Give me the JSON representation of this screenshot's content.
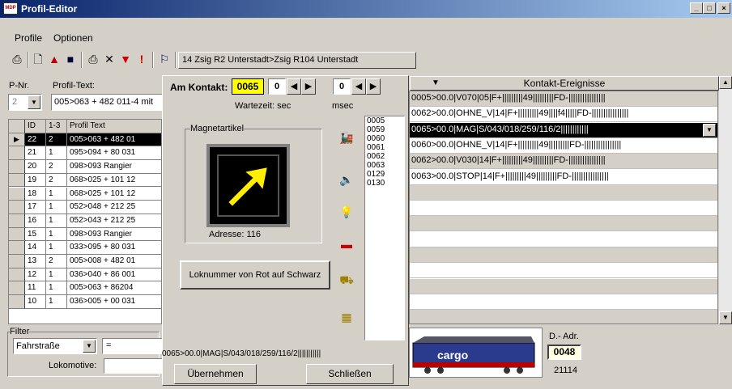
{
  "window": {
    "title": "Profil-Editor",
    "logo": "MDP",
    "min": "_",
    "max": "□",
    "close": "×"
  },
  "menu": {
    "profile": "Profile",
    "optionen": "Optionen"
  },
  "toolbar": {
    "icons": [
      "refresh-icon",
      "new-document-icon",
      "open-icon",
      "save-icon",
      "print-icon",
      "delete-icon",
      "filter-icon",
      "alert-icon",
      "network-icon"
    ],
    "route_label": "14 Zsig R2 Unterstadt>Zsig R104 Unterstadt"
  },
  "left": {
    "pnr_label": "P-Nr.",
    "pnr_value": "2",
    "profil_text_label": "Profil-Text:",
    "profil_text_value": "005>063 + 482 011-4 mit",
    "grid": {
      "headers": [
        "ID",
        "1-3",
        "Profil Text"
      ],
      "rows": [
        {
          "id": "22",
          "n": "2",
          "text": "005>063 + 482 01"
        },
        {
          "id": "21",
          "n": "1",
          "text": "095>094 + 80 031"
        },
        {
          "id": "20",
          "n": "2",
          "text": "098>093 Rangier"
        },
        {
          "id": "19",
          "n": "2",
          "text": "068>025 + 101 12"
        },
        {
          "id": "18",
          "n": "1",
          "text": "068>025 + 101 12"
        },
        {
          "id": "17",
          "n": "1",
          "text": "052>048 + 212 25"
        },
        {
          "id": "16",
          "n": "1",
          "text": "052>043 + 212 25"
        },
        {
          "id": "15",
          "n": "1",
          "text": "098>093 Rangier"
        },
        {
          "id": "14",
          "n": "1",
          "text": "033>095 + 80 031"
        },
        {
          "id": "13",
          "n": "2",
          "text": "005>008 + 482 01"
        },
        {
          "id": "12",
          "n": "1",
          "text": "036>040 + 86 001"
        },
        {
          "id": "11",
          "n": "1",
          "text": "005>063 + 86204"
        },
        {
          "id": "10",
          "n": "1",
          "text": "036>005 + 00 031"
        }
      ]
    },
    "filter_label": "Filter",
    "filter_select": "Fahrstraße",
    "filter_op": "=",
    "lokomotive_label": "Lokomotive:"
  },
  "mid": {
    "am_kontakt_label": "Am Kontakt:",
    "kontakt_value": "0065",
    "spin1_value": "0",
    "spin2_value": "0",
    "wartezeit_label": "Wartezeit: sec",
    "msec_label": "msec",
    "magnetartikel_label": "Magnetartikel",
    "adresse_label": "Adresse: 116",
    "lok_button": "Loknummer von Rot auf Schwarz",
    "contacts": [
      "0005",
      "0059",
      "0060",
      "0061",
      "0062",
      "0063",
      "0129",
      "0130"
    ],
    "status_line": "0065>00.0|MAG|S/043/018/259/116/2|||||||||||",
    "uebernehmen": "Übernehmen",
    "schliessen": "Schließen",
    "side_icons": [
      "locomotive-icon",
      "horn-icon",
      "lamp-icon",
      "signal-icon",
      "cab-icon",
      "grid-icon"
    ]
  },
  "right": {
    "header": "Kontakt-Ereignisse",
    "rows": [
      "0005>00.0|V070|05|F+|||||||||49|||||||||FD-||||||||||||||||",
      "0062>00.0|OHNE_V|14|F+|||||||||49||||f4|||||FD-||||||||||||||||",
      "0065>00.0|MAG|S/043/018/259/116/2||||||||||||",
      "0060>00.0|OHNE_V|14|F+|||||||||49|||||||||FD-||||||||||||||||",
      "0062>00.0|V030|14|F+|||||||||49|||||||||FD-||||||||||||||||",
      "0063>00.0|STOP|14|F+|||||||||49|||||||||FD-||||||||||||||||"
    ],
    "d_adr_label": "D.- Adr.",
    "d_adr_value": "0048",
    "loco_number": "21114",
    "loco_brand": "cargo"
  },
  "colors": {
    "title_start": "#0a246a",
    "title_end": "#a6caf0",
    "highlight": "#ffff00",
    "magnet_arrow": "#ffee00"
  }
}
